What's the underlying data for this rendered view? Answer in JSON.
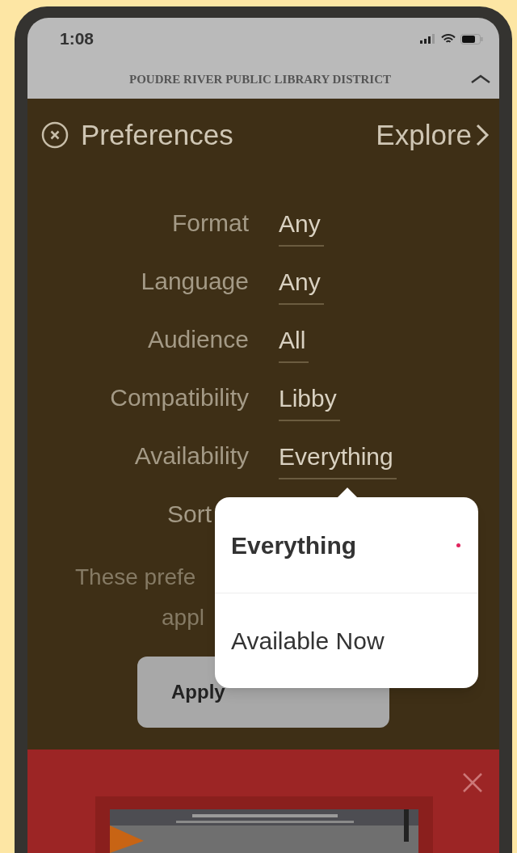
{
  "status_bar": {
    "time": "1:08"
  },
  "header": {
    "library_name": "POUDRE RIVER PUBLIC LIBRARY DISTRICT"
  },
  "nav": {
    "title": "Preferences",
    "explore": "Explore"
  },
  "preferences": [
    {
      "label": "Format",
      "value": "Any"
    },
    {
      "label": "Language",
      "value": "Any"
    },
    {
      "label": "Audience",
      "value": "All"
    },
    {
      "label": "Compatibility",
      "value": "Libby"
    },
    {
      "label": "Availability",
      "value": "Everything"
    },
    {
      "label": "Sort"
    }
  ],
  "note": [
    "These prefe",
    "appl"
  ],
  "apply_button": "Apply",
  "popup": {
    "options": [
      {
        "label": "Everything",
        "selected": true
      },
      {
        "label": "Available Now",
        "selected": false
      }
    ]
  }
}
